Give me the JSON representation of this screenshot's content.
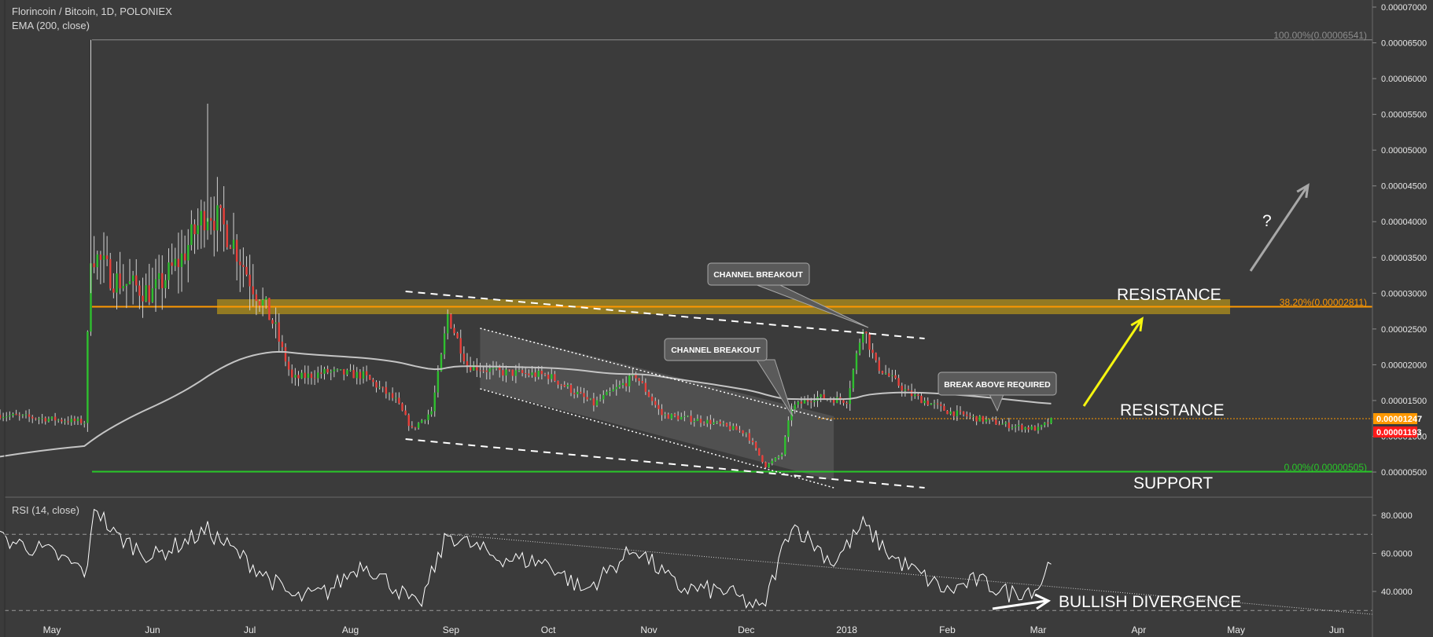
{
  "chart_data": [
    {
      "type": "candlestick",
      "title": "Florincoin / Bitcoin, 1D, POLONIEX",
      "indicator_label": "EMA (200, close)",
      "y_axis": {
        "ticks": [
          "0.00007000",
          "0.00006500",
          "0.00006000",
          "0.00005500",
          "0.00005000",
          "0.00004500",
          "0.00004000",
          "0.00003500",
          "0.00003000",
          "0.00002500",
          "0.00002000",
          "0.00001500",
          "0.00001000",
          "0.00000500"
        ],
        "tick_values": [
          7e-05,
          6.5e-05,
          6e-05,
          5.5e-05,
          5e-05,
          4.5e-05,
          4e-05,
          3.5e-05,
          3e-05,
          2.5e-05,
          2e-05,
          1.5e-05,
          1e-05,
          5e-06
        ]
      },
      "x_axis": {
        "ticks": [
          "May",
          "Jun",
          "Jul",
          "Aug",
          "Sep",
          "Oct",
          "Nov",
          "Dec",
          "2018",
          "Feb",
          "Mar",
          "Apr",
          "May",
          "Jun"
        ]
      },
      "fib_levels": [
        {
          "label": "100.00%(0.00006541)",
          "value": 6.541e-05,
          "color": "#9a9a9a"
        },
        {
          "label": "38.20%(0.00002811)",
          "value": 2.811e-05,
          "color": "#ff9800"
        },
        {
          "label": "0.00%(0.00000505)",
          "value": 5.05e-06,
          "color": "#28c828"
        }
      ],
      "price_tags": [
        {
          "label": "0.00001247",
          "value": 1.247e-05,
          "color": "#ff9800"
        },
        {
          "label": "0.00001193",
          "value": 1.193e-05,
          "color": "#ff1a1a"
        }
      ],
      "annotations": {
        "resistance_upper": "RESISTANCE",
        "resistance_lower": "RESISTANCE",
        "support": "SUPPORT",
        "question": "?",
        "callout_1": "CHANNEL BREAKOUT",
        "callout_2": "CHANNEL BREAKOUT",
        "callout_3": "BREAK ABOVE REQUIRED"
      },
      "series_approx": [
        {
          "name": "price",
          "x": [
            "2017-05-12",
            "2017-05-13",
            "2017-06-18",
            "2017-07-10",
            "2017-08-18",
            "2017-08-30",
            "2017-10-01",
            "2017-11-01",
            "2017-12-06",
            "2017-12-15",
            "2018-01-06",
            "2018-02-01",
            "2018-03-05"
          ],
          "y": [
            1.25e-05,
            4e-05,
            4.5e-05,
            2e-05,
            1.1e-05,
            2.8e-05,
            1.8e-05,
            1.6e-05,
            5.5e-06,
            1.5e-05,
            2.6e-05,
            1.3e-05,
            1.2e-05
          ]
        },
        {
          "name": "EMA (200, close)",
          "x": [
            "2017-04-15",
            "2017-05-15",
            "2017-07-10",
            "2017-09-01",
            "2017-12-01",
            "2018-01-01",
            "2018-03-05"
          ],
          "y": [
            7e-06,
            9e-06,
            2e-05,
            1.9e-05,
            1.5e-05,
            1.45e-05,
            1.38e-05
          ]
        }
      ]
    },
    {
      "type": "line",
      "title": "RSI (14, close)",
      "y_axis": {
        "ticks": [
          "80.0000",
          "60.0000",
          "40.0000"
        ],
        "tick_values": [
          80,
          60,
          40
        ]
      },
      "overbought": 70,
      "oversold": 30,
      "annotation": "BULLISH DIVERGENCE"
    }
  ]
}
